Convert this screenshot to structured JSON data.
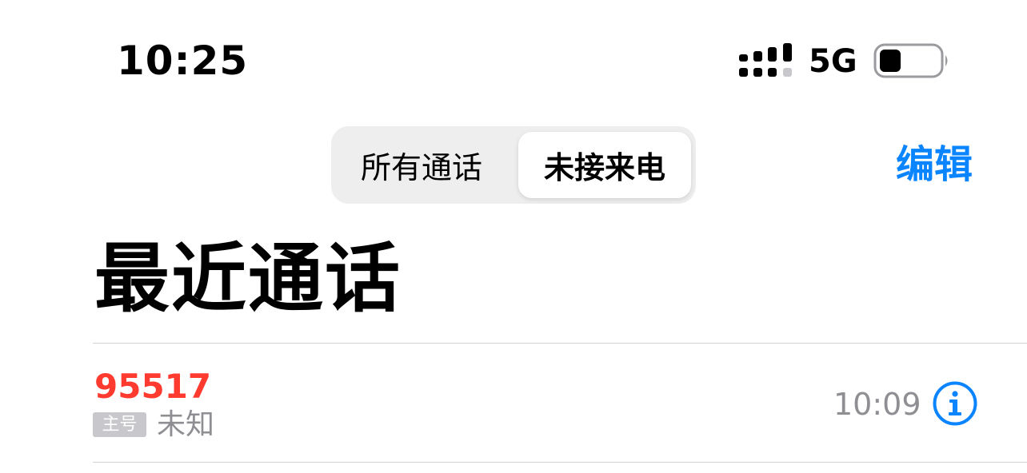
{
  "status_bar": {
    "time": "10:25",
    "network": "5G",
    "signal_icon": "signal-bars-icon",
    "battery_icon": "battery-icon",
    "battery_level": 0.2
  },
  "segmented_control": {
    "all_calls_label": "所有通话",
    "missed_calls_label": "未接来电",
    "selected": "未接来电"
  },
  "header": {
    "edit_label": "编辑",
    "title": "最近通话"
  },
  "calls": [
    {
      "number": "95517",
      "line_badge": "主号",
      "type": "未知",
      "time": "10:09",
      "info_icon": "info-icon"
    }
  ],
  "colors": {
    "accent": "#0a84ff",
    "missed": "#ff3b30",
    "secondary_text": "#8e8e93",
    "badge_bg": "#c7c7cc",
    "segment_bg": "#eeeeef"
  }
}
